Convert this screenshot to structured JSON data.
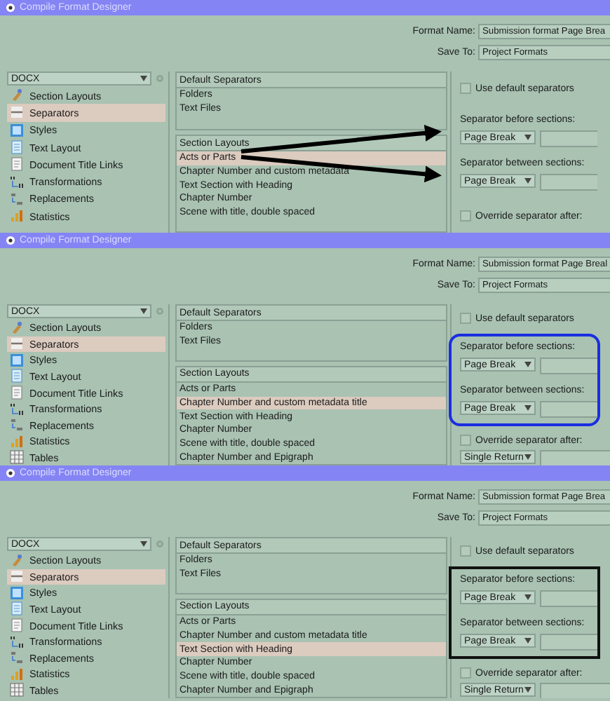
{
  "panels": [
    {
      "title": "Compile Format Designer",
      "kind": "arrows",
      "format_name_label": "Format Name:",
      "format_name": "Submission format Page Brea",
      "save_to_label": "Save To:",
      "save_to": "Project Formats",
      "format": "DOCX",
      "nav": [
        {
          "label": "Section Layouts",
          "selected": false
        },
        {
          "label": "Separators",
          "selected": true
        },
        {
          "label": "Styles",
          "selected": false
        },
        {
          "label": "Text Layout",
          "selected": false
        },
        {
          "label": "Document Title Links",
          "selected": false
        },
        {
          "label": "Transformations",
          "selected": false
        },
        {
          "label": "Replacements",
          "selected": false
        },
        {
          "label": "Statistics",
          "selected": false
        }
      ],
      "default_header": "Default Separators",
      "default_items": [
        "Folders",
        "Text Files"
      ],
      "layouts_header": "Section Layouts",
      "layouts": [
        {
          "label": "Acts or Parts",
          "selected": true
        },
        {
          "label": "Chapter Number and custom metadata",
          "selected": false
        },
        {
          "label": "Text Section with Heading",
          "selected": false
        },
        {
          "label": "Chapter Number",
          "selected": false
        },
        {
          "label": "Scene with title, double spaced",
          "selected": false
        }
      ],
      "use_default": {
        "label": "Use default separators",
        "checked": false
      },
      "before_label": "Separator before sections:",
      "before": "Page Break",
      "between_label": "Separator between sections:",
      "between": "Page Break",
      "override": {
        "label": "Override separator after:",
        "checked": false
      }
    },
    {
      "title": "Compile Format Designer",
      "kind": "blue-outline",
      "format_name_label": "Format Name:",
      "format_name": "Submission format Page Breal",
      "save_to_label": "Save To:",
      "save_to": "Project Formats",
      "format": "DOCX",
      "nav": [
        {
          "label": "Section Layouts",
          "selected": false
        },
        {
          "label": "Separators",
          "selected": true
        },
        {
          "label": "Styles",
          "selected": false
        },
        {
          "label": "Text Layout",
          "selected": false
        },
        {
          "label": "Document Title Links",
          "selected": false
        },
        {
          "label": "Transformations",
          "selected": false
        },
        {
          "label": "Replacements",
          "selected": false
        },
        {
          "label": "Statistics",
          "selected": false
        },
        {
          "label": "Tables",
          "selected": false
        }
      ],
      "default_header": "Default Separators",
      "default_items": [
        "Folders",
        "Text Files"
      ],
      "layouts_header": "Section Layouts",
      "layouts": [
        {
          "label": "Acts or Parts",
          "selected": false
        },
        {
          "label": "Chapter Number and custom metadata title",
          "selected": true
        },
        {
          "label": "Text Section with Heading",
          "selected": false
        },
        {
          "label": "Chapter Number",
          "selected": false
        },
        {
          "label": "Scene with title, double spaced",
          "selected": false
        },
        {
          "label": "Chapter Number and Epigraph",
          "selected": false
        }
      ],
      "use_default": {
        "label": "Use default separators",
        "checked": false
      },
      "before_label": "Separator before sections:",
      "before": "Page Break",
      "between_label": "Separator between sections:",
      "between": "Page Break",
      "override": {
        "label": "Override separator after:",
        "checked": false
      },
      "after": "Single Return"
    },
    {
      "title": "Compile Format Designer",
      "kind": "black-outline",
      "format_name_label": "Format Name:",
      "format_name": "Submission format Page Brea",
      "save_to_label": "Save To:",
      "save_to": "Project Formats",
      "format": "DOCX",
      "nav": [
        {
          "label": "Section Layouts",
          "selected": false
        },
        {
          "label": "Separators",
          "selected": true
        },
        {
          "label": "Styles",
          "selected": false
        },
        {
          "label": "Text Layout",
          "selected": false
        },
        {
          "label": "Document Title Links",
          "selected": false
        },
        {
          "label": "Transformations",
          "selected": false
        },
        {
          "label": "Replacements",
          "selected": false
        },
        {
          "label": "Statistics",
          "selected": false
        },
        {
          "label": "Tables",
          "selected": false
        }
      ],
      "default_header": "Default Separators",
      "default_items": [
        "Folders",
        "Text Files"
      ],
      "layouts_header": "Section Layouts",
      "layouts": [
        {
          "label": "Acts or Parts",
          "selected": false
        },
        {
          "label": "Chapter Number and custom metadata title",
          "selected": false
        },
        {
          "label": "Text Section with Heading",
          "selected": true
        },
        {
          "label": "Chapter Number",
          "selected": false
        },
        {
          "label": "Scene with title, double spaced",
          "selected": false
        },
        {
          "label": "Chapter Number and Epigraph",
          "selected": false
        }
      ],
      "use_default": {
        "label": "Use default separators",
        "checked": false
      },
      "before_label": "Separator before sections:",
      "before": "Page Break",
      "between_label": "Separator between sections:",
      "between": "Page Break",
      "override": {
        "label": "Override separator after:",
        "checked": false
      },
      "after": "Single Return"
    }
  ]
}
